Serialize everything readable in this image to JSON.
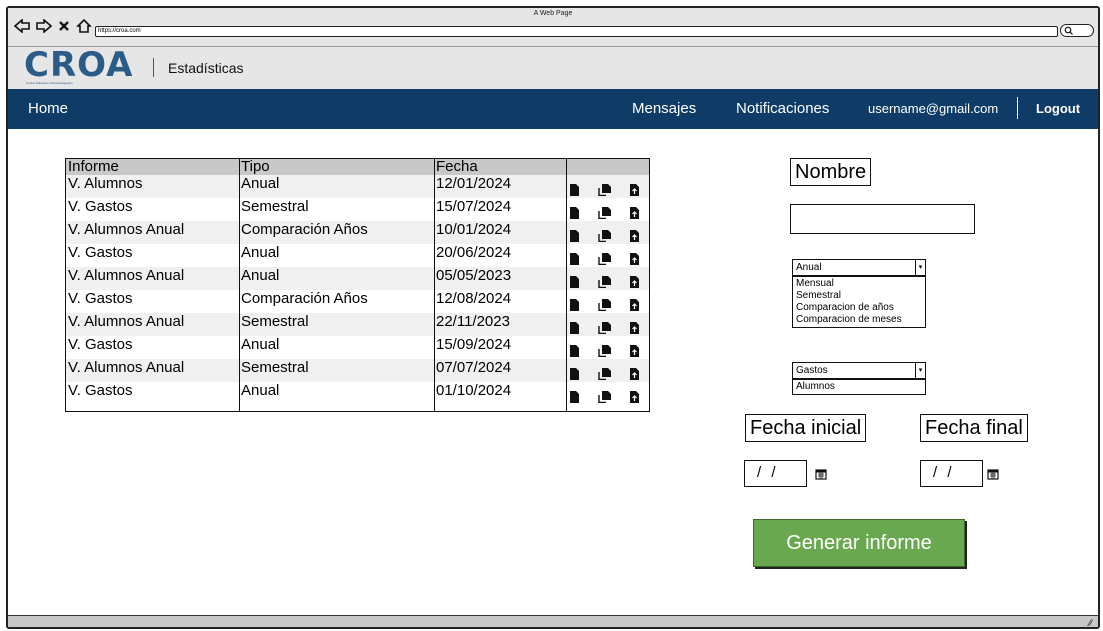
{
  "browser": {
    "window_title": "A Web Page",
    "url": "https://croa.com"
  },
  "header": {
    "logo_text": "CROA",
    "logo_subtitle": "Centro Educativo Psicopedagógico",
    "page_title": "Estadísticas"
  },
  "nav": {
    "home": "Home",
    "messages": "Mensajes",
    "notifications": "Notificaciones",
    "email": "username@gmail.com",
    "logout": "Logout"
  },
  "table": {
    "columns": [
      "Informe",
      "Tipo",
      "Fecha",
      ""
    ],
    "rows": [
      {
        "informe": "V. Alumnos",
        "tipo": "Anual",
        "fecha": "12/01/2024"
      },
      {
        "informe": "V. Gastos",
        "tipo": "Semestral",
        "fecha": "15/07/2024"
      },
      {
        "informe": "V. Alumnos Anual",
        "tipo": "Comparación Años",
        "fecha": "10/01/2024"
      },
      {
        "informe": "V. Gastos",
        "tipo": "Anual",
        "fecha": "20/06/2024"
      },
      {
        "informe": "V. Alumnos Anual",
        "tipo": "Anual",
        "fecha": "05/05/2023"
      },
      {
        "informe": "V. Gastos",
        "tipo": "Comparación Años",
        "fecha": "12/08/2024"
      },
      {
        "informe": "V. Alumnos Anual",
        "tipo": "Semestral",
        "fecha": "22/11/2023"
      },
      {
        "informe": "V. Gastos",
        "tipo": "Anual",
        "fecha": "15/09/2024"
      },
      {
        "informe": "V. Alumnos Anual",
        "tipo": "Semestral",
        "fecha": "07/07/2024"
      },
      {
        "informe": "V. Gastos",
        "tipo": "Anual",
        "fecha": "01/10/2024"
      }
    ],
    "row_icons": [
      "file-icon",
      "copy-icon",
      "file-upload-icon"
    ]
  },
  "form": {
    "name_label": "Nombre",
    "name_value": "",
    "period_select": {
      "selected": "Anual",
      "options": [
        "Mensual",
        "Semestral",
        "Comparacion de años",
        "Comparacion de meses"
      ]
    },
    "type_select": {
      "selected": "Gastos",
      "options": [
        "Alumnos"
      ]
    },
    "start_date_label": "Fecha inicial",
    "end_date_label": "Fecha final",
    "start_date_value": "/ /",
    "end_date_value": "/ /",
    "generate_button": "Generar informe"
  },
  "colors": {
    "navbar": "#0e3c66",
    "logo": "#2b5b87",
    "button": "#6aa84f"
  }
}
